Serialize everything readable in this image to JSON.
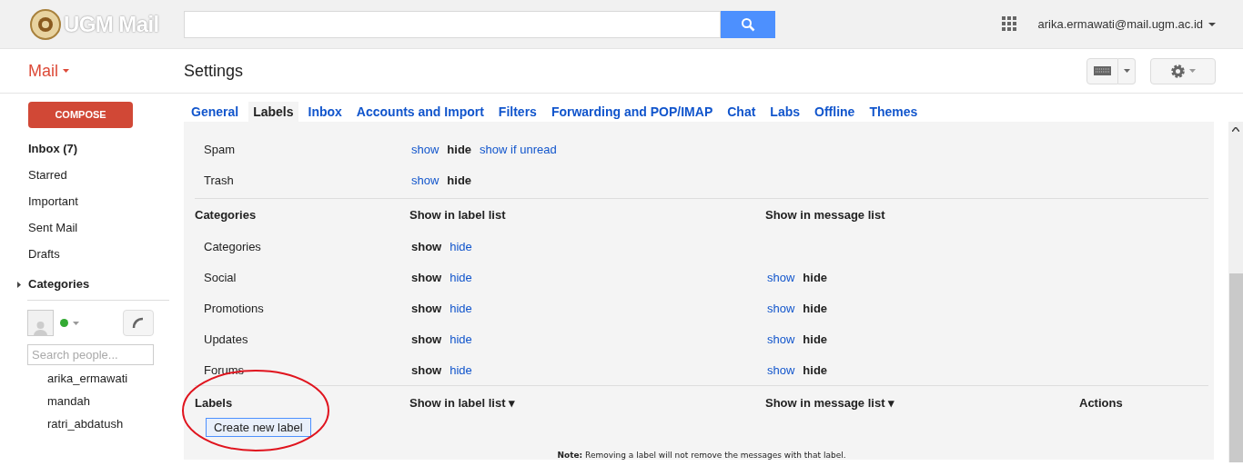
{
  "header": {
    "logo": "UGM Mail",
    "account": "arika.ermawati@mail.ugm.ac.id"
  },
  "toolbar": {
    "app_menu": "Mail",
    "title": "Settings"
  },
  "sidebar": {
    "compose": "COMPOSE",
    "items": [
      {
        "label": "Inbox (7)",
        "bold": true
      },
      {
        "label": "Starred",
        "bold": false
      },
      {
        "label": "Important",
        "bold": false
      },
      {
        "label": "Sent Mail",
        "bold": false
      },
      {
        "label": "Drafts",
        "bold": false
      }
    ],
    "categories": {
      "label": "Categories",
      "expanded": false
    },
    "chat": {
      "status": {
        "color": "#33aa33"
      },
      "search": {
        "placeholder": "Search people..."
      },
      "contacts": [
        "arika_ermawati",
        "mandah",
        "ratri_abdatush"
      ]
    }
  },
  "tabs": [
    {
      "label": "General",
      "selected": false
    },
    {
      "label": "Labels",
      "selected": true
    },
    {
      "label": "Inbox",
      "selected": false
    },
    {
      "label": "Accounts and Import",
      "selected": false
    },
    {
      "label": "Filters",
      "selected": false
    },
    {
      "label": "Forwarding and POP/IMAP",
      "selected": false
    },
    {
      "label": "Chat",
      "selected": false
    },
    {
      "label": "Labs",
      "selected": false
    },
    {
      "label": "Offline",
      "selected": false
    },
    {
      "label": "Themes",
      "selected": false
    }
  ],
  "system_labels": [
    {
      "name": "Spam",
      "label_list": [
        {
          "text": "show",
          "selected": false
        },
        {
          "text": "hide",
          "selected": true
        },
        {
          "text": "show if unread",
          "selected": false
        }
      ]
    },
    {
      "name": "Trash",
      "label_list": [
        {
          "text": "show",
          "selected": false
        },
        {
          "text": "hide",
          "selected": true
        }
      ]
    }
  ],
  "categories": {
    "columns": [
      "Categories",
      "Show in label list",
      "Show in message list"
    ],
    "rows": [
      {
        "name": "Categories",
        "label_list": [
          {
            "text": "show",
            "selected": true
          },
          {
            "text": "hide",
            "selected": false
          }
        ],
        "message_list": []
      },
      {
        "name": "Social",
        "label_list": [
          {
            "text": "show",
            "selected": true
          },
          {
            "text": "hide",
            "selected": false
          }
        ],
        "message_list": [
          {
            "text": "show",
            "selected": false
          },
          {
            "text": "hide",
            "selected": true
          }
        ]
      },
      {
        "name": "Promotions",
        "label_list": [
          {
            "text": "show",
            "selected": true
          },
          {
            "text": "hide",
            "selected": false
          }
        ],
        "message_list": [
          {
            "text": "show",
            "selected": false
          },
          {
            "text": "hide",
            "selected": true
          }
        ]
      },
      {
        "name": "Updates",
        "label_list": [
          {
            "text": "show",
            "selected": true
          },
          {
            "text": "hide",
            "selected": false
          }
        ],
        "message_list": [
          {
            "text": "show",
            "selected": false
          },
          {
            "text": "hide",
            "selected": true
          }
        ]
      },
      {
        "name": "Forums",
        "label_list": [
          {
            "text": "show",
            "selected": true
          },
          {
            "text": "hide",
            "selected": false
          }
        ],
        "message_list": [
          {
            "text": "show",
            "selected": false
          },
          {
            "text": "hide",
            "selected": true
          }
        ]
      }
    ]
  },
  "labels": {
    "columns": [
      "Labels",
      "Show in label list ▾",
      "Show in message list ▾",
      "Actions"
    ],
    "create_button": "Create new label",
    "note": "**Note:** Removing a label will not remove the messages with that label."
  }
}
